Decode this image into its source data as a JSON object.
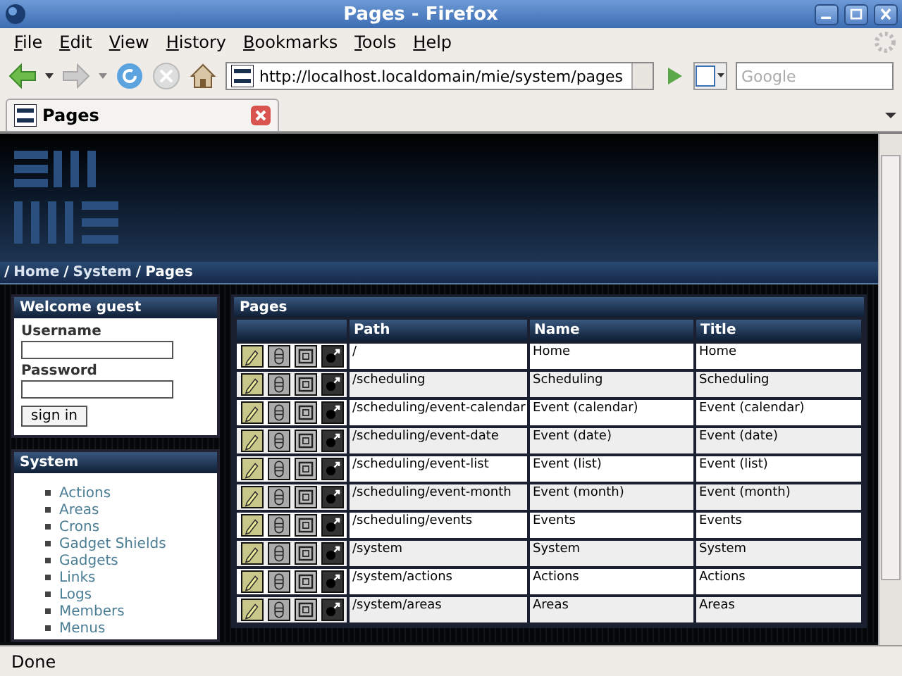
{
  "window": {
    "title": "Pages - Firefox"
  },
  "menu": [
    "File",
    "Edit",
    "View",
    "History",
    "Bookmarks",
    "Tools",
    "Help"
  ],
  "address": {
    "url": "http://localhost.localdomain/mie/system/pages"
  },
  "search": {
    "placeholder": "Google"
  },
  "tabs": [
    {
      "label": "Pages",
      "selected": true
    }
  ],
  "breadcrumb": {
    "separator": "/",
    "links": [
      "Home",
      "System"
    ],
    "current": "Pages"
  },
  "login": {
    "title": "Welcome guest",
    "username_label": "Username",
    "password_label": "Password",
    "button": "sign in"
  },
  "system": {
    "title": "System",
    "items": [
      "Actions",
      "Areas",
      "Crons",
      "Gadget Shields",
      "Gadgets",
      "Links",
      "Logs",
      "Members",
      "Menus"
    ]
  },
  "table": {
    "title": "Pages",
    "columns": [
      "Path",
      "Name",
      "Title"
    ],
    "rows": [
      {
        "path": "/",
        "name": "Home",
        "title": "Home"
      },
      {
        "path": "/scheduling",
        "name": "Scheduling",
        "title": "Scheduling"
      },
      {
        "path": "/scheduling/event-calendar",
        "name": "Event (calendar)",
        "title": "Event (calendar)"
      },
      {
        "path": "/scheduling/event-date",
        "name": "Event (date)",
        "title": "Event (date)"
      },
      {
        "path": "/scheduling/event-list",
        "name": "Event (list)",
        "title": "Event (list)"
      },
      {
        "path": "/scheduling/event-month",
        "name": "Event (month)",
        "title": "Event (month)"
      },
      {
        "path": "/scheduling/events",
        "name": "Events",
        "title": "Events"
      },
      {
        "path": "/system",
        "name": "System",
        "title": "System"
      },
      {
        "path": "/system/actions",
        "name": "Actions",
        "title": "Actions"
      },
      {
        "path": "/system/areas",
        "name": "Areas",
        "title": "Areas"
      }
    ]
  },
  "status_bar": {
    "text": "Done"
  }
}
